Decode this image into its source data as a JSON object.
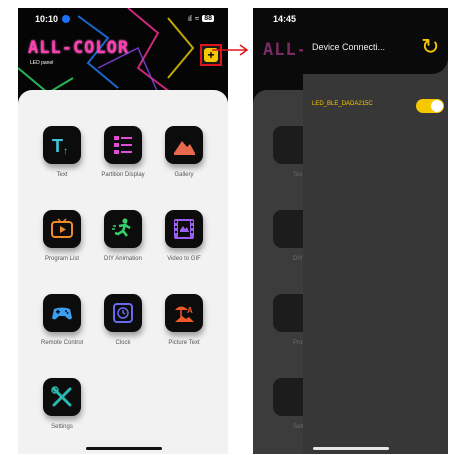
{
  "left_phone": {
    "status": {
      "time": "10:10",
      "signal": "📶",
      "wifi": "⌔",
      "battery": "88"
    },
    "brand": {
      "title": "ALL-COLOR",
      "subtitle": "LED panel"
    },
    "add_button": {
      "icon": "plus-icon",
      "glyph": "+"
    },
    "apps": [
      {
        "label": "Text",
        "icon": "text-icon",
        "color": "#3fc4d8"
      },
      {
        "label": "Partition Display",
        "icon": "partition-icon",
        "color": "#e04ed6"
      },
      {
        "label": "Gallery",
        "icon": "gallery-icon",
        "color": "#e86a4c"
      },
      {
        "label": "Program List",
        "icon": "program-list-icon",
        "color": "#f08a2a"
      },
      {
        "label": "DIY Animation",
        "icon": "diy-animation-icon",
        "color": "#35d16a"
      },
      {
        "label": "Video to GIF",
        "icon": "video-gif-icon",
        "color": "#9a5ef0"
      },
      {
        "label": "Remote Control",
        "icon": "gamepad-icon",
        "color": "#3a9ff0"
      },
      {
        "label": "Clock",
        "icon": "clock-icon",
        "color": "#6a6af0"
      },
      {
        "label": "Picture Text",
        "icon": "picture-text-icon",
        "color": "#f05a2a"
      },
      {
        "label": "Settings",
        "icon": "settings-icon",
        "color": "#2ab8b0"
      }
    ]
  },
  "right_phone": {
    "status": {
      "time": "14:45",
      "signal": "📶",
      "wifi": "⌔",
      "battery": "79"
    },
    "background_brand": "ALL-CO",
    "panel": {
      "title": "Device Connecti...",
      "refresh_icon": "refresh-icon",
      "devices": [
        {
          "name": "LED_BLE_DADA215C",
          "connected": true
        }
      ]
    },
    "ghost_labels": [
      "Tex",
      "DIY A",
      "Prog",
      "Setti"
    ]
  },
  "colors": {
    "accent_yellow": "#f6c800",
    "highlight_red": "#e0141c",
    "brand_pink": "#ff3fb4"
  }
}
